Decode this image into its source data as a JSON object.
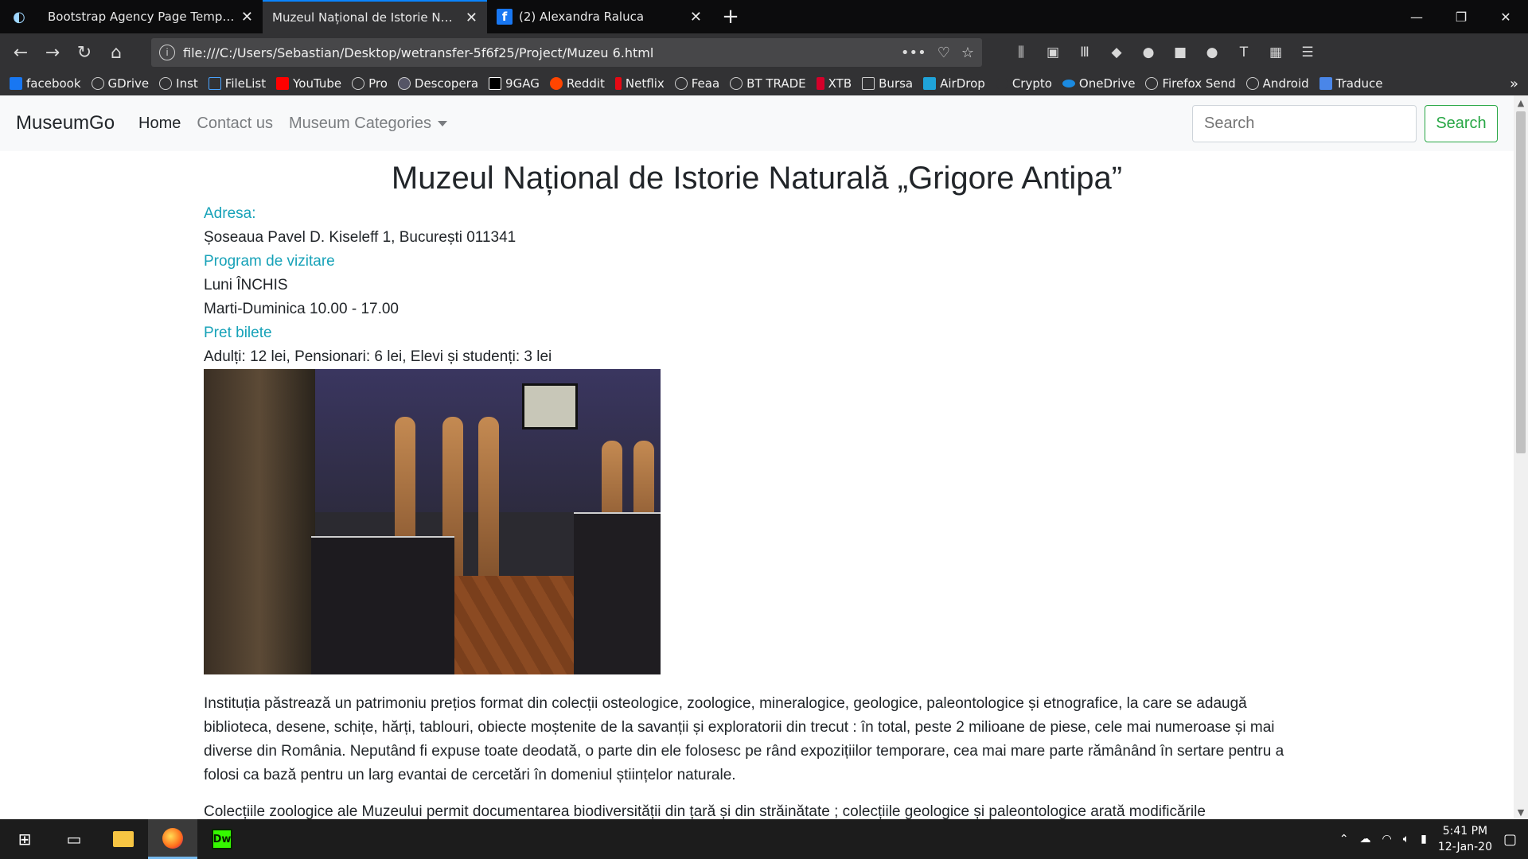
{
  "browser": {
    "tabs": [
      {
        "label": "Bootstrap Agency Page Template",
        "active": false
      },
      {
        "label": "Muzeul Național de Istorie Naturală „Grigore Antipa”",
        "active": true
      },
      {
        "label": "(2) Alexandra Raluca",
        "active": false
      }
    ],
    "url": "file:///C:/Users/Sebastian/Desktop/wetransfer-5f6f25/Project/Muzeu 6.html",
    "bookmarks": [
      "facebook",
      "GDrive",
      "Inst",
      "FileList",
      "YouTube",
      "Pro",
      "Descopera",
      "9GAG",
      "Reddit",
      "Netflix",
      "Feaa",
      "BT TRADE",
      "XTB",
      "Bursa",
      "AirDrop",
      "Crypto",
      "OneDrive",
      "Firefox Send",
      "Android",
      "Traduce"
    ]
  },
  "site": {
    "brand": "MuseumGo",
    "nav": {
      "home": "Home",
      "contact": "Contact us",
      "categories": "Museum Categories"
    },
    "search": {
      "placeholder": "Search",
      "button": "Search"
    }
  },
  "page": {
    "title": "Muzeul Național de Istorie Naturală „Grigore Antipa”",
    "address_label": "Adresa:",
    "address_value": "Șoseaua Pavel D. Kiseleff 1, București 011341",
    "schedule_label": "Program de vizitare",
    "schedule_monday": "Luni ÎNCHIS",
    "schedule_rest": "Marti-Duminica 10.00 - 17.00",
    "price_label": "Pret bilete",
    "price_value": "Adulți: 12 lei, Pensionari: 6 lei, Elevi și studenți: 3 lei",
    "paragraph1": "Instituția păstrează un patrimoniu prețios format din colecții osteologice, zoologice, mineralogice, geologice, paleontologice și etnografice, la care se adaugă biblioteca, desene, schițe, hărți, tablouri, obiecte moștenite de la savanții și exploratorii din trecut : în total, peste 2 milioane de piese, cele mai numeroase și mai diverse din România. Neputând fi expuse toate deodată, o parte din ele folosesc pe rând expozițiilor temporare, cea mai mare parte rămânând în sertare pentru a folosi ca bază pentru un larg evantai de cercetări în domeniul științelor naturale.",
    "paragraph2": "Colecțiile zoologice ale Muzeului permit documentarea biodiversității din țară și din străinătate ; colecțiile geologice și paleontologice arată modificările"
  },
  "taskbar": {
    "time": "5:41 PM",
    "date": "12-Jan-20",
    "dw_label": "Dw"
  }
}
